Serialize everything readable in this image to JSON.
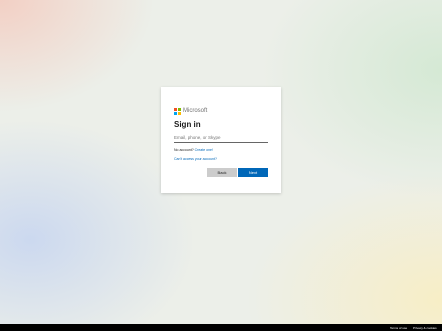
{
  "brand": {
    "name": "Microsoft",
    "logo_colors": [
      "#f25022",
      "#7fba00",
      "#00a4ef",
      "#ffb900"
    ]
  },
  "signin": {
    "title": "Sign in",
    "email_placeholder": "Email, phone, or Skype",
    "email_value": "",
    "no_account_text": "No account?",
    "create_link": "Create one!",
    "cant_access_link": "Can't access your account?"
  },
  "buttons": {
    "back_label": "Back",
    "next_label": "Next"
  },
  "footer": {
    "terms": "Terms of use",
    "privacy": "Privacy & cookies"
  },
  "colors": {
    "accent": "#0067b8",
    "back_button": "#cccccc",
    "footer": "#000000"
  }
}
